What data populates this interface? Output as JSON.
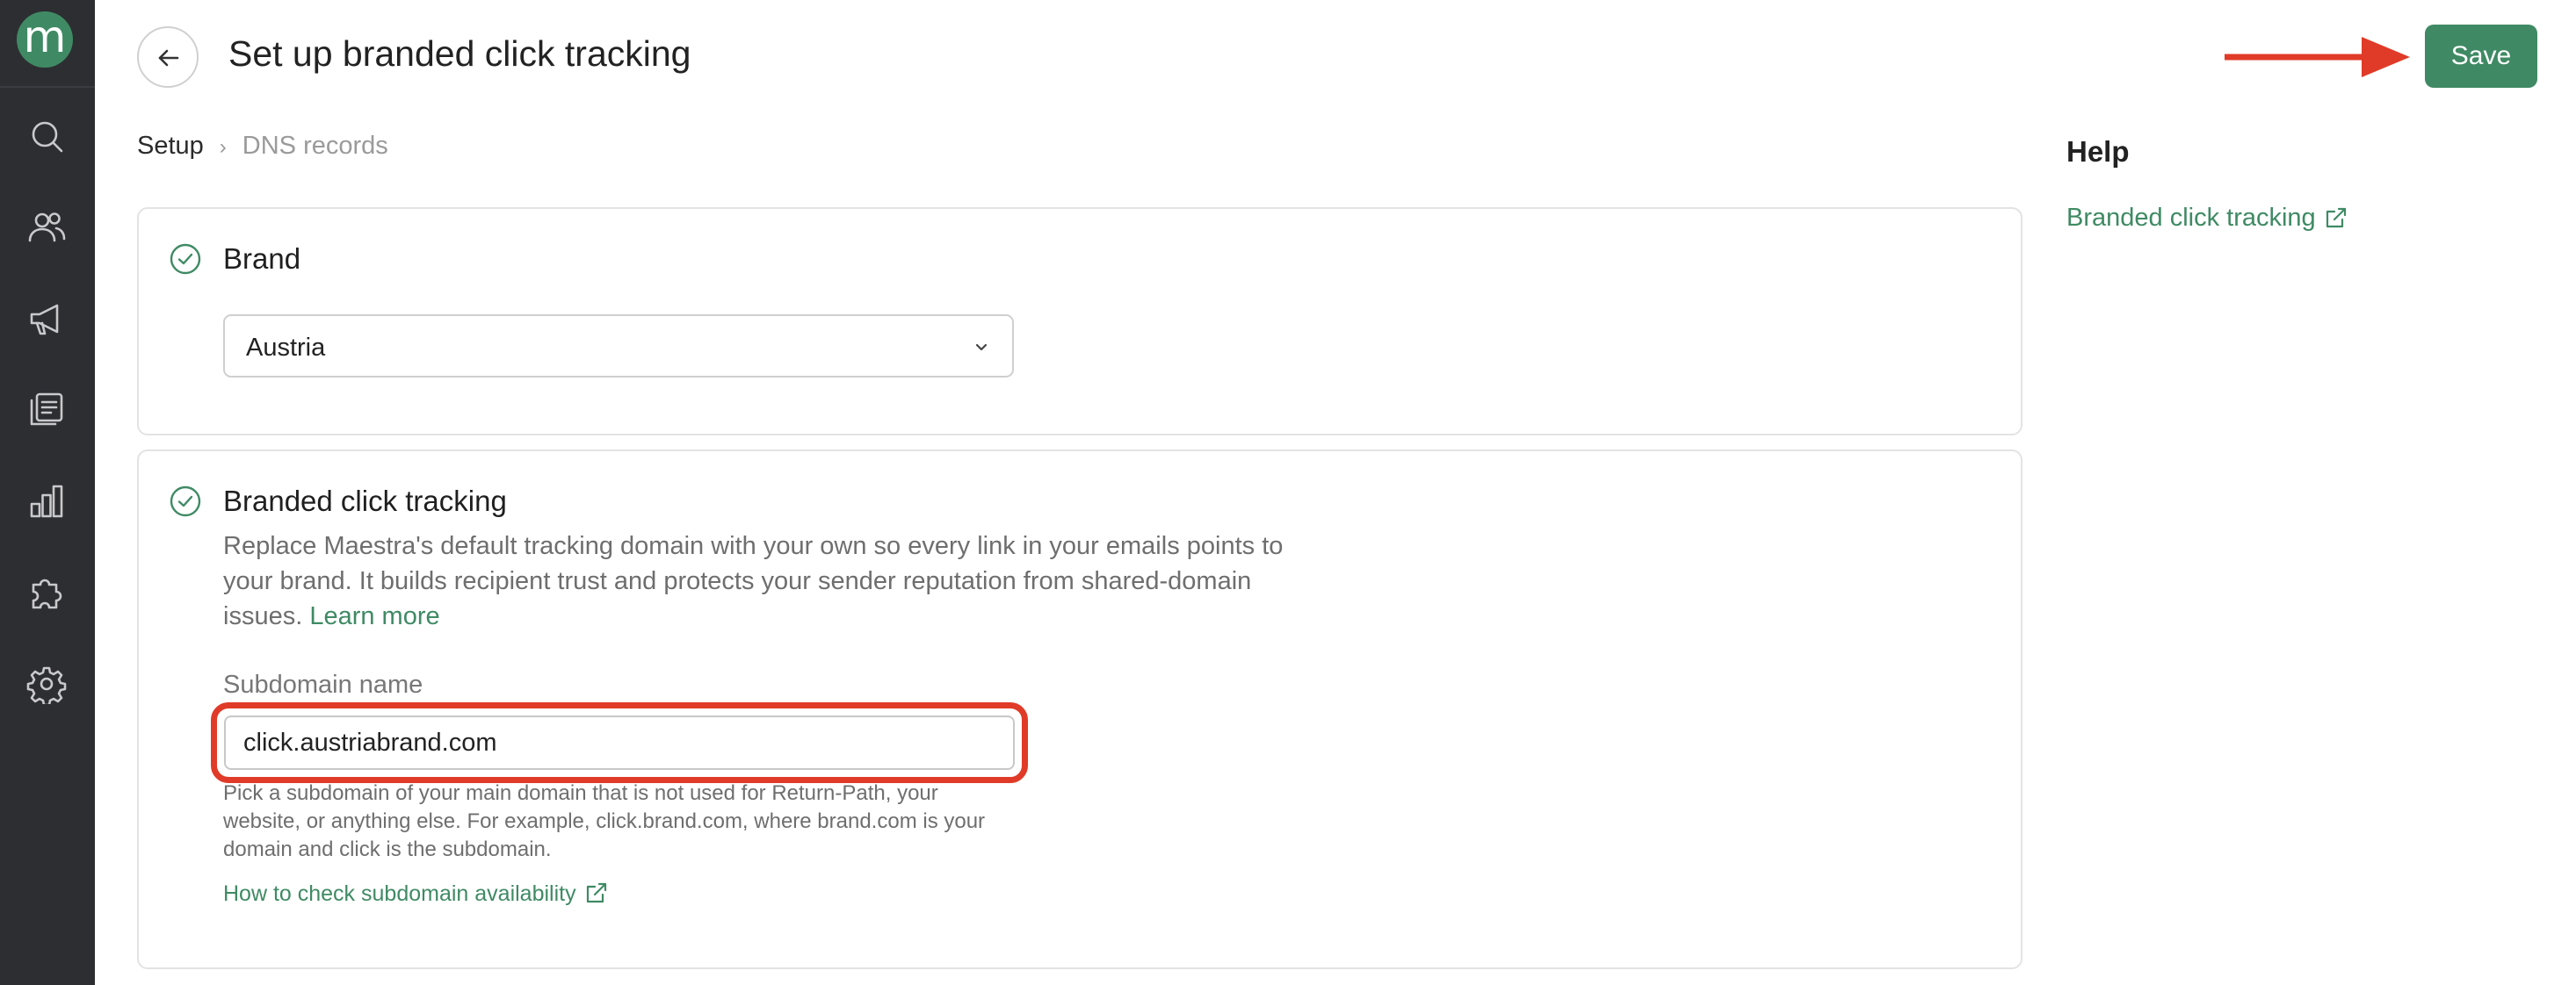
{
  "sidebar": {
    "logo_letter": "m",
    "items": [
      {
        "icon": "search-icon"
      },
      {
        "icon": "users-icon"
      },
      {
        "icon": "megaphone-icon"
      },
      {
        "icon": "content-icon"
      },
      {
        "icon": "analytics-icon"
      },
      {
        "icon": "integrations-icon"
      },
      {
        "icon": "settings-icon"
      }
    ]
  },
  "header": {
    "title": "Set up branded click tracking",
    "save_label": "Save"
  },
  "breadcrumb": {
    "current": "Setup",
    "separator": "›",
    "next": "DNS records"
  },
  "brand_section": {
    "title": "Brand",
    "selected": "Austria"
  },
  "tracking_section": {
    "title": "Branded click tracking",
    "description": "Replace Maestra's default tracking domain with your own so every link in your emails points to your brand. It builds recipient trust and protects your sender reputation from shared-domain issues.",
    "learn_more": "Learn more",
    "field_label": "Subdomain name",
    "field_value": "click.austriabrand.com",
    "hint": "Pick a subdomain of your main domain that is not used for Return-Path, your website, or anything else. For example, click.brand.com, where brand.com is your domain and click is the subdomain.",
    "check_link": "How to check subdomain availability"
  },
  "help": {
    "title": "Help",
    "link": "Branded click tracking"
  },
  "colors": {
    "accent": "#3f8a64",
    "sidebar": "#2d2e32",
    "highlight": "#e03b28"
  }
}
